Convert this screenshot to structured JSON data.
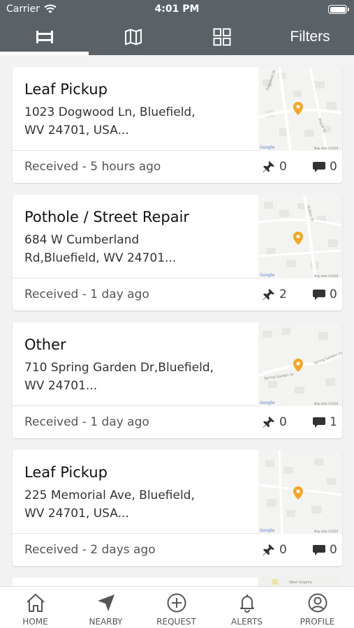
{
  "status_bar": {
    "carrier": "Carrier",
    "time": "4:01 PM"
  },
  "top_tabs": {
    "filters_label": "Filters",
    "icons": [
      "list-icon",
      "map-icon",
      "grid-icon"
    ]
  },
  "colors": {
    "header": "#5a6268",
    "pin": "#f5a623",
    "background": "#f2f2f2"
  },
  "requests": [
    {
      "title": "Leaf Pickup",
      "address_line1": "1023 Dogwood Ln, Bluefield,",
      "address_line2": "WV 24701, USA...",
      "status": "Received - 5 hours ago",
      "pins": "0",
      "comments": "0",
      "map_street": "Dogwood Dr",
      "map_street2": "Maple St"
    },
    {
      "title": "Pothole / Street Repair",
      "address_line1": "684 W Cumberland",
      "address_line2": "Rd,Bluefield, WV 24701...",
      "status": "Received - 1 day ago",
      "pins": "2",
      "comments": "0",
      "map_street": "Dufour St",
      "map_street2": ""
    },
    {
      "title": "Other",
      "address_line1": "710 Spring Garden Dr,Bluefield,",
      "address_line2": "WV 24701...",
      "status": "Received - 1 day ago",
      "pins": "0",
      "comments": "1",
      "map_street": "Spring Garden Dr",
      "map_street2": "Spring Garden Dr"
    },
    {
      "title": "Leaf Pickup",
      "address_line1": "225 Memorial Ave, Bluefield,",
      "address_line2": "WV 24701, USA...",
      "status": "Received - 2 days ago",
      "pins": "0",
      "comments": "0",
      "map_street": "",
      "map_street2": ""
    }
  ],
  "map_labels": {
    "google": "Google",
    "map_data": "Map data ©2020"
  },
  "peek_map_label": "West Virginia",
  "bottom_nav": [
    {
      "label": "HOME",
      "icon": "home-icon"
    },
    {
      "label": "NEARBY",
      "icon": "navigation-arrow-icon"
    },
    {
      "label": "REQUEST",
      "icon": "plus-circle-icon"
    },
    {
      "label": "ALERTS",
      "icon": "bell-icon"
    },
    {
      "label": "PROFILE",
      "icon": "user-circle-icon"
    }
  ]
}
